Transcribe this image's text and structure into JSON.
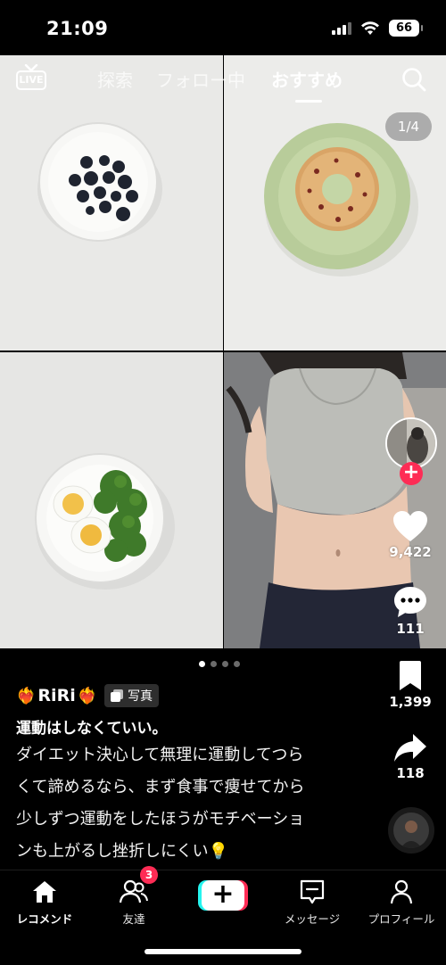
{
  "status_bar": {
    "time": "21:09",
    "battery": "66"
  },
  "top_nav": {
    "live_label": "LIVE",
    "tabs": [
      {
        "label": "探索",
        "active": false
      },
      {
        "label": "フォロー中",
        "active": false
      },
      {
        "label": "おすすめ",
        "active": true
      }
    ]
  },
  "media": {
    "page_counter": "1/4",
    "current_page": 1,
    "total_pages": 4
  },
  "actions": {
    "likes": "9,422",
    "comments": "111",
    "bookmarks": "1,399",
    "shares": "118"
  },
  "post": {
    "author": "RiRi",
    "author_emoji": "❤️‍🔥",
    "type_badge": "写真",
    "title": "運動はしなくていい。",
    "body_lines": [
      "ダイエット決心して無理に運動してつら",
      "くて諦めるなら、まず食事で痩せてから",
      "少しずつ運動をしたほうがモチベーショ",
      "ンも上がるし挫折しにくい💡"
    ]
  },
  "bottom_nav": {
    "items": [
      {
        "label": "レコメンド",
        "icon": "home-icon",
        "active": true
      },
      {
        "label": "友達",
        "icon": "friends-icon",
        "badge": "3"
      },
      {
        "label": "",
        "icon": "create-icon"
      },
      {
        "label": "メッセージ",
        "icon": "inbox-icon"
      },
      {
        "label": "プロフィール",
        "icon": "profile-icon"
      }
    ]
  },
  "colors": {
    "accent": "#fe2c55",
    "cyan": "#25f4ee",
    "background": "#000000"
  }
}
